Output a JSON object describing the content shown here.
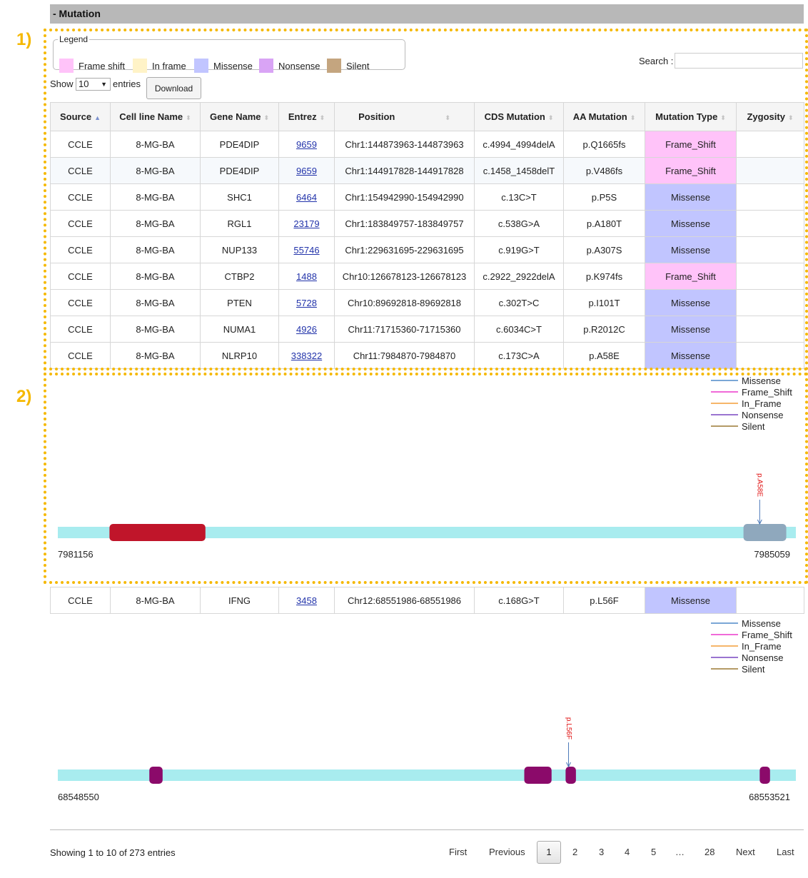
{
  "panel": {
    "title": "- Mutation"
  },
  "annotations": {
    "label1": "1)",
    "label2": "2)"
  },
  "legend": {
    "title": "Legend",
    "items": [
      {
        "label": "Frame shift",
        "color": "#ffc3f9"
      },
      {
        "label": "In frame",
        "color": "#fff3c7"
      },
      {
        "label": "Missense",
        "color": "#c1c5ff"
      },
      {
        "label": "Nonsense",
        "color": "#d9a4f5"
      },
      {
        "label": "Silent",
        "color": "#c4a57f"
      }
    ]
  },
  "search": {
    "label": "Search :",
    "value": ""
  },
  "length_menu": {
    "show": "Show",
    "value": "10",
    "entries": "entries"
  },
  "download": {
    "label": "Download"
  },
  "columns": [
    "Source",
    "Cell line Name",
    "Gene Name",
    "Entrez",
    "Position",
    "CDS Mutation",
    "AA Mutation",
    "Mutation Type",
    "Zygosity"
  ],
  "type_colors": {
    "Frame_Shift": "#ffc3f9",
    "Missense": "#c1c5ff"
  },
  "rows": [
    {
      "source": "CCLE",
      "cell": "8-MG-BA",
      "gene": "PDE4DIP",
      "entrez": "9659",
      "position": "Chr1:144873963-144873963",
      "cds": "c.4994_4994delA",
      "aa": "p.Q1665fs",
      "type": "Frame_Shift",
      "zyg": ""
    },
    {
      "source": "CCLE",
      "cell": "8-MG-BA",
      "gene": "PDE4DIP",
      "entrez": "9659",
      "position": "Chr1:144917828-144917828",
      "cds": "c.1458_1458delT",
      "aa": "p.V486fs",
      "type": "Frame_Shift",
      "zyg": ""
    },
    {
      "source": "CCLE",
      "cell": "8-MG-BA",
      "gene": "SHC1",
      "entrez": "6464",
      "position": "Chr1:154942990-154942990",
      "cds": "c.13C>T",
      "aa": "p.P5S",
      "type": "Missense",
      "zyg": ""
    },
    {
      "source": "CCLE",
      "cell": "8-MG-BA",
      "gene": "RGL1",
      "entrez": "23179",
      "position": "Chr1:183849757-183849757",
      "cds": "c.538G>A",
      "aa": "p.A180T",
      "type": "Missense",
      "zyg": ""
    },
    {
      "source": "CCLE",
      "cell": "8-MG-BA",
      "gene": "NUP133",
      "entrez": "55746",
      "position": "Chr1:229631695-229631695",
      "cds": "c.919G>T",
      "aa": "p.A307S",
      "type": "Missense",
      "zyg": ""
    },
    {
      "source": "CCLE",
      "cell": "8-MG-BA",
      "gene": "CTBP2",
      "entrez": "1488",
      "position": "Chr10:126678123-126678123",
      "cds": "c.2922_2922delA",
      "aa": "p.K974fs",
      "type": "Frame_Shift",
      "zyg": ""
    },
    {
      "source": "CCLE",
      "cell": "8-MG-BA",
      "gene": "PTEN",
      "entrez": "5728",
      "position": "Chr10:89692818-89692818",
      "cds": "c.302T>C",
      "aa": "p.I101T",
      "type": "Missense",
      "zyg": ""
    },
    {
      "source": "CCLE",
      "cell": "8-MG-BA",
      "gene": "NUMA1",
      "entrez": "4926",
      "position": "Chr11:71715360-71715360",
      "cds": "c.6034C>T",
      "aa": "p.R2012C",
      "type": "Missense",
      "zyg": ""
    },
    {
      "source": "CCLE",
      "cell": "8-MG-BA",
      "gene": "NLRP10",
      "entrez": "338322",
      "position": "Chr11:7984870-7984870",
      "cds": "c.173C>A",
      "aa": "p.A58E",
      "type": "Missense",
      "zyg": ""
    }
  ],
  "row10": {
    "source": "CCLE",
    "cell": "8-MG-BA",
    "gene": "IFNG",
    "entrez": "3458",
    "position": "Chr12:68551986-68551986",
    "cds": "c.168G>T",
    "aa": "p.L56F",
    "type": "Missense",
    "zyg": ""
  },
  "viz_legend": [
    {
      "label": "Missense",
      "color": "#7aa7d6"
    },
    {
      "label": "Frame_Shift",
      "color": "#f06ad8"
    },
    {
      "label": "In_Frame",
      "color": "#f6b66a"
    },
    {
      "label": "Nonsense",
      "color": "#9a74d0"
    },
    {
      "label": "Silent",
      "color": "#b49a66"
    }
  ],
  "viz1": {
    "start": "7981156",
    "end": "7985059",
    "backbone_color": "#a8ecef",
    "domains": [
      {
        "from": 0.07,
        "to": 0.2,
        "color": "#c0152a"
      },
      {
        "from": 0.929,
        "to": 0.987,
        "color": "#8fa8bd"
      }
    ],
    "mutations": [
      {
        "pos": 0.951,
        "label": "p.A58E"
      }
    ]
  },
  "viz2": {
    "start": "68548550",
    "end": "68553521",
    "backbone_color": "#a8ecef",
    "domains": [
      {
        "from": 0.124,
        "to": 0.142,
        "color": "#8b0a6a"
      },
      {
        "from": 0.632,
        "to": 0.669,
        "color": "#8b0a6a"
      },
      {
        "from": 0.688,
        "to": 0.702,
        "color": "#8b0a6a"
      },
      {
        "from": 0.951,
        "to": 0.965,
        "color": "#8b0a6a"
      }
    ],
    "mutations": [
      {
        "pos": 0.692,
        "label": "p.L56F"
      }
    ]
  },
  "footer": {
    "info": "Showing 1 to 10 of 273 entries",
    "first": "First",
    "previous": "Previous",
    "pages": [
      "1",
      "2",
      "3",
      "4",
      "5",
      "…",
      "28"
    ],
    "next": "Next",
    "last": "Last"
  }
}
